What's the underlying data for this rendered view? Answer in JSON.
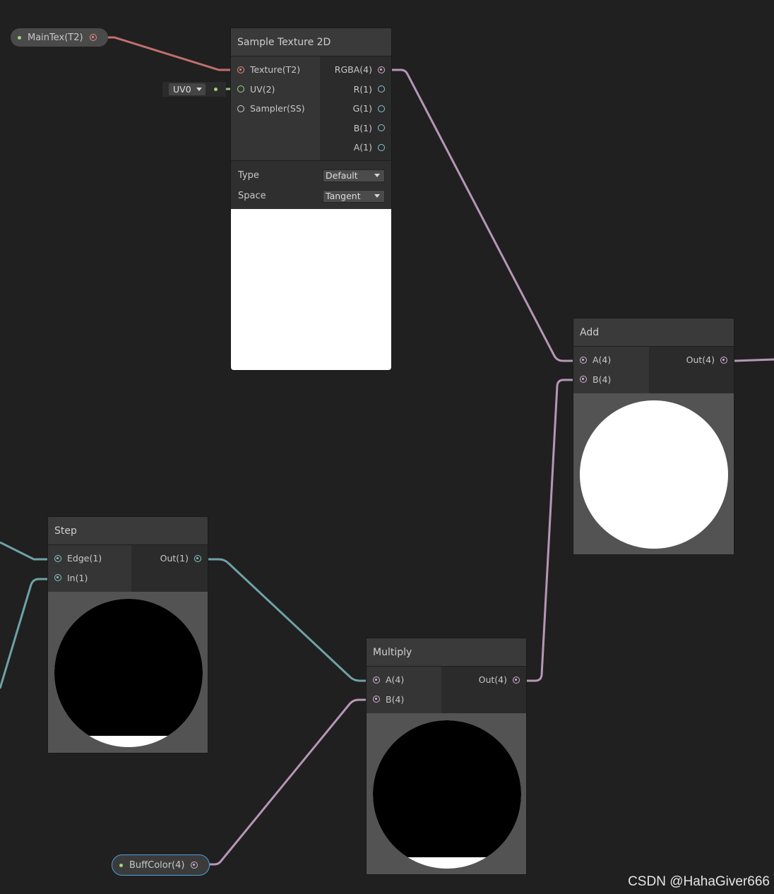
{
  "properties": {
    "main_tex": "MainTex(T2)",
    "buff_color": "BuffColor(4)"
  },
  "uv_dropdown": {
    "value": "UV0"
  },
  "nodes": {
    "sample_texture": {
      "title": "Sample Texture 2D",
      "inputs": [
        "Texture(T2)",
        "UV(2)",
        "Sampler(SS)"
      ],
      "outputs": [
        "RGBA(4)",
        "R(1)",
        "G(1)",
        "B(1)",
        "A(1)"
      ],
      "settings": [
        {
          "label": "Type",
          "value": "Default"
        },
        {
          "label": "Space",
          "value": "Tangent"
        }
      ]
    },
    "add": {
      "title": "Add",
      "inputs": [
        "A(4)",
        "B(4)"
      ],
      "outputs": [
        "Out(4)"
      ]
    },
    "step": {
      "title": "Step",
      "inputs": [
        "Edge(1)",
        "In(1)"
      ],
      "outputs": [
        "Out(1)"
      ]
    },
    "multiply": {
      "title": "Multiply",
      "inputs": [
        "A(4)",
        "B(4)"
      ],
      "outputs": [
        "Out(4)"
      ]
    }
  },
  "watermark": "CSDN @HahaGiver666",
  "colors": {
    "background": "#202020",
    "texture_wire": "#c0706e",
    "vector4_wire": "#b796b6",
    "vector1_wire": "#6fa2a6",
    "vector2_wire": "#8bc57c",
    "selection": "#4aa3e0"
  }
}
